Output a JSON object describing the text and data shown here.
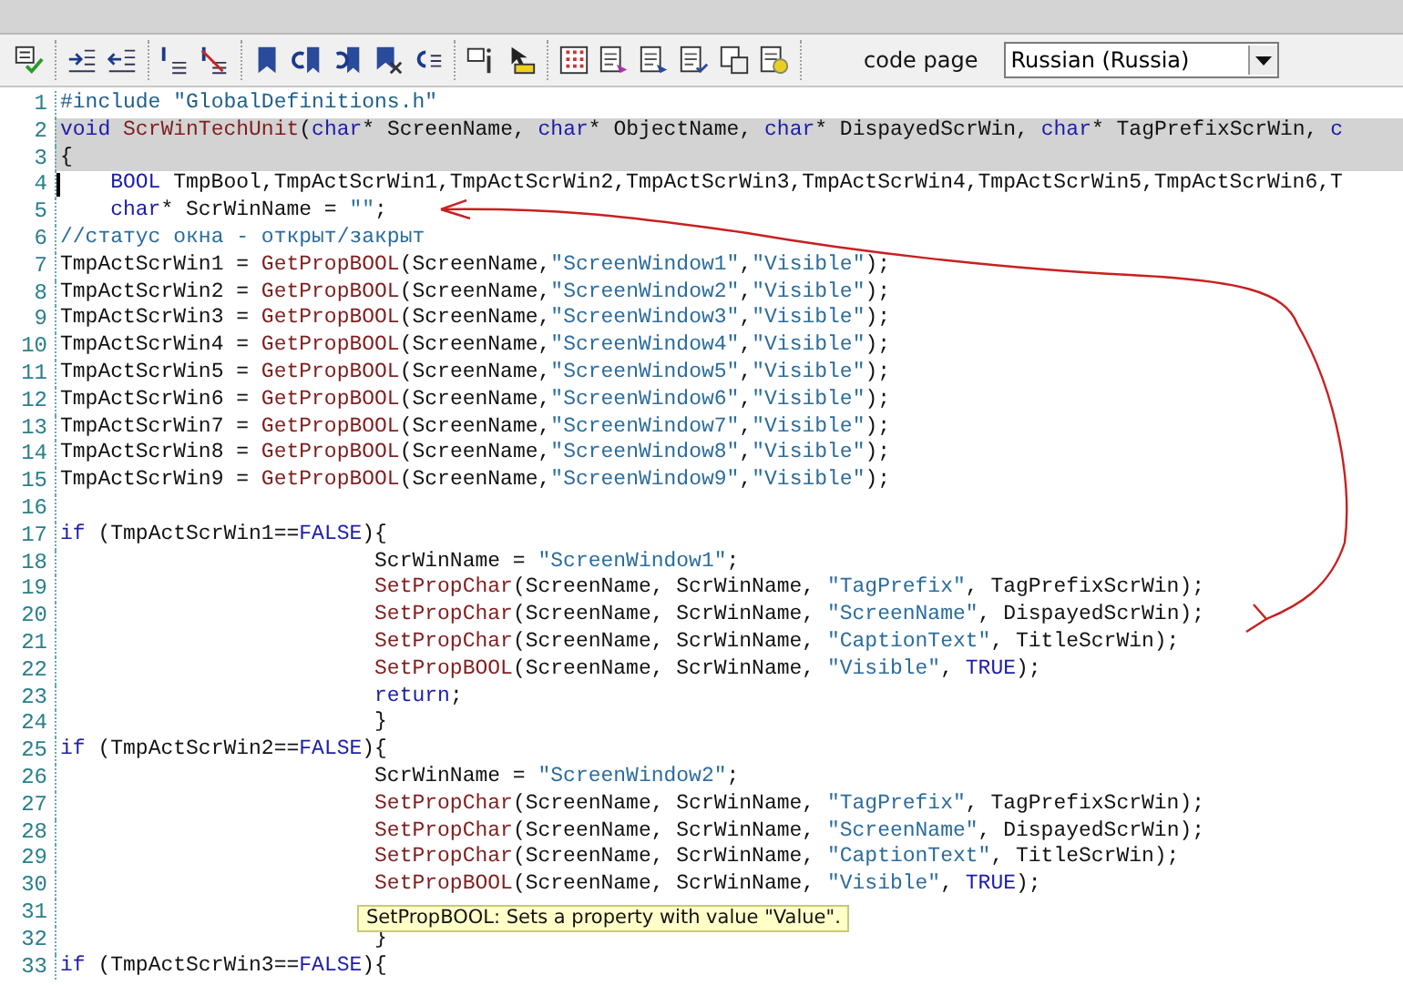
{
  "toolbar": {
    "code_page_label": "code page",
    "code_page_value": "Russian (Russia)"
  },
  "editor": {
    "lines": [
      {
        "number": "1",
        "kind": "top",
        "highlighted": false,
        "cursor": false,
        "tokens": [
          {
            "kind": "directive",
            "text": "#include \"GlobalDefinitions.h\""
          }
        ]
      },
      {
        "number": "2",
        "kind": "top",
        "highlighted": true,
        "cursor": false,
        "tokens": [
          {
            "kind": "keyword",
            "text": "void"
          },
          {
            "kind": "function",
            "text": " ScrWinTechUnit"
          },
          {
            "kind": "plain",
            "text": "("
          },
          {
            "kind": "keyword",
            "text": "char"
          },
          {
            "kind": "plain",
            "text": "* ScreenName, "
          },
          {
            "kind": "keyword",
            "text": "char"
          },
          {
            "kind": "plain",
            "text": "* ObjectName, "
          },
          {
            "kind": "keyword",
            "text": "char"
          },
          {
            "kind": "plain",
            "text": "* DispayedScrWin, "
          },
          {
            "kind": "keyword",
            "text": "char"
          },
          {
            "kind": "plain",
            "text": "* TagPrefixScrWin, "
          },
          {
            "kind": "keyword",
            "text": "c"
          }
        ]
      },
      {
        "number": "3",
        "kind": "top",
        "highlighted": true,
        "cursor": false,
        "tokens": [
          {
            "kind": "plain",
            "text": "{"
          }
        ]
      },
      {
        "number": "4",
        "kind": "body",
        "highlighted": false,
        "cursor": true,
        "tokens": [
          {
            "kind": "keyword",
            "text": "BOOL"
          },
          {
            "kind": "plain",
            "text": " TmpBool,TmpActScrWin1,TmpActScrWin2,TmpActScrWin3,TmpActScrWin4,TmpActScrWin5,TmpActScrWin6,T"
          }
        ]
      },
      {
        "number": "5",
        "kind": "body",
        "highlighted": false,
        "cursor": false,
        "tokens": [
          {
            "kind": "keyword",
            "text": "char"
          },
          {
            "kind": "plain",
            "text": "* ScrWinName = "
          },
          {
            "kind": "string",
            "text": "\"\""
          },
          {
            "kind": "plain",
            "text": ";"
          }
        ]
      },
      {
        "number": "6",
        "kind": "top",
        "highlighted": false,
        "cursor": false,
        "tokens": [
          {
            "kind": "comment",
            "text": "//статус окна - открыт/закрыт"
          }
        ]
      },
      {
        "number": "7",
        "kind": "top",
        "highlighted": false,
        "cursor": false,
        "tokens": [
          {
            "kind": "plain",
            "text": "TmpActScrWin1 = "
          },
          {
            "kind": "function",
            "text": "GetPropBOOL"
          },
          {
            "kind": "plain",
            "text": "(ScreenName,"
          },
          {
            "kind": "string",
            "text": "\"ScreenWindow1\""
          },
          {
            "kind": "plain",
            "text": ","
          },
          {
            "kind": "string",
            "text": "\"Visible\""
          },
          {
            "kind": "plain",
            "text": ");"
          }
        ]
      },
      {
        "number": "8",
        "kind": "top",
        "highlighted": false,
        "cursor": false,
        "tokens": [
          {
            "kind": "plain",
            "text": "TmpActScrWin2 = "
          },
          {
            "kind": "function",
            "text": "GetPropBOOL"
          },
          {
            "kind": "plain",
            "text": "(ScreenName,"
          },
          {
            "kind": "string",
            "text": "\"ScreenWindow2\""
          },
          {
            "kind": "plain",
            "text": ","
          },
          {
            "kind": "string",
            "text": "\"Visible\""
          },
          {
            "kind": "plain",
            "text": ");"
          }
        ]
      },
      {
        "number": "9",
        "kind": "top",
        "highlighted": false,
        "cursor": false,
        "tokens": [
          {
            "kind": "plain",
            "text": "TmpActScrWin3 = "
          },
          {
            "kind": "function",
            "text": "GetPropBOOL"
          },
          {
            "kind": "plain",
            "text": "(ScreenName,"
          },
          {
            "kind": "string",
            "text": "\"ScreenWindow3\""
          },
          {
            "kind": "plain",
            "text": ","
          },
          {
            "kind": "string",
            "text": "\"Visible\""
          },
          {
            "kind": "plain",
            "text": ");"
          }
        ]
      },
      {
        "number": "10",
        "kind": "top",
        "highlighted": false,
        "cursor": false,
        "tokens": [
          {
            "kind": "plain",
            "text": "TmpActScrWin4 = "
          },
          {
            "kind": "function",
            "text": "GetPropBOOL"
          },
          {
            "kind": "plain",
            "text": "(ScreenName,"
          },
          {
            "kind": "string",
            "text": "\"ScreenWindow4\""
          },
          {
            "kind": "plain",
            "text": ","
          },
          {
            "kind": "string",
            "text": "\"Visible\""
          },
          {
            "kind": "plain",
            "text": ");"
          }
        ]
      },
      {
        "number": "11",
        "kind": "top",
        "highlighted": false,
        "cursor": false,
        "tokens": [
          {
            "kind": "plain",
            "text": "TmpActScrWin5 = "
          },
          {
            "kind": "function",
            "text": "GetPropBOOL"
          },
          {
            "kind": "plain",
            "text": "(ScreenName,"
          },
          {
            "kind": "string",
            "text": "\"ScreenWindow5\""
          },
          {
            "kind": "plain",
            "text": ","
          },
          {
            "kind": "string",
            "text": "\"Visible\""
          },
          {
            "kind": "plain",
            "text": ");"
          }
        ]
      },
      {
        "number": "12",
        "kind": "top",
        "highlighted": false,
        "cursor": false,
        "tokens": [
          {
            "kind": "plain",
            "text": "TmpActScrWin6 = "
          },
          {
            "kind": "function",
            "text": "GetPropBOOL"
          },
          {
            "kind": "plain",
            "text": "(ScreenName,"
          },
          {
            "kind": "string",
            "text": "\"ScreenWindow6\""
          },
          {
            "kind": "plain",
            "text": ","
          },
          {
            "kind": "string",
            "text": "\"Visible\""
          },
          {
            "kind": "plain",
            "text": ");"
          }
        ]
      },
      {
        "number": "13",
        "kind": "top",
        "highlighted": false,
        "cursor": false,
        "tokens": [
          {
            "kind": "plain",
            "text": "TmpActScrWin7 = "
          },
          {
            "kind": "function",
            "text": "GetPropBOOL"
          },
          {
            "kind": "plain",
            "text": "(ScreenName,"
          },
          {
            "kind": "string",
            "text": "\"ScreenWindow7\""
          },
          {
            "kind": "plain",
            "text": ","
          },
          {
            "kind": "string",
            "text": "\"Visible\""
          },
          {
            "kind": "plain",
            "text": ");"
          }
        ]
      },
      {
        "number": "14",
        "kind": "top",
        "highlighted": false,
        "cursor": false,
        "tokens": [
          {
            "kind": "plain",
            "text": "TmpActScrWin8 = "
          },
          {
            "kind": "function",
            "text": "GetPropBOOL"
          },
          {
            "kind": "plain",
            "text": "(ScreenName,"
          },
          {
            "kind": "string",
            "text": "\"ScreenWindow8\""
          },
          {
            "kind": "plain",
            "text": ","
          },
          {
            "kind": "string",
            "text": "\"Visible\""
          },
          {
            "kind": "plain",
            "text": ");"
          }
        ]
      },
      {
        "number": "15",
        "kind": "top",
        "highlighted": false,
        "cursor": false,
        "tokens": [
          {
            "kind": "plain",
            "text": "TmpActScrWin9 = "
          },
          {
            "kind": "function",
            "text": "GetPropBOOL"
          },
          {
            "kind": "plain",
            "text": "(ScreenName,"
          },
          {
            "kind": "string",
            "text": "\"ScreenWindow9\""
          },
          {
            "kind": "plain",
            "text": ","
          },
          {
            "kind": "string",
            "text": "\"Visible\""
          },
          {
            "kind": "plain",
            "text": ");"
          }
        ]
      },
      {
        "number": "16",
        "kind": "top",
        "highlighted": false,
        "cursor": false
      },
      {
        "number": "17",
        "kind": "top",
        "highlighted": false,
        "cursor": false,
        "tokens": [
          {
            "kind": "keyword",
            "text": "if"
          },
          {
            "kind": "plain",
            "text": " (TmpActScrWin1=="
          },
          {
            "kind": "keyword",
            "text": "FALSE"
          },
          {
            "kind": "plain",
            "text": "){"
          }
        ]
      },
      {
        "number": "18",
        "kind": "inner",
        "highlighted": false,
        "cursor": false,
        "tokens": [
          {
            "kind": "plain",
            "text": "ScrWinName = "
          },
          {
            "kind": "string",
            "text": "\"ScreenWindow1\""
          },
          {
            "kind": "plain",
            "text": ";"
          }
        ]
      },
      {
        "number": "19",
        "kind": "inner",
        "highlighted": false,
        "cursor": false,
        "tokens": [
          {
            "kind": "function",
            "text": "SetPropChar"
          },
          {
            "kind": "plain",
            "text": "(ScreenName, ScrWinName, "
          },
          {
            "kind": "string",
            "text": "\"TagPrefix\""
          },
          {
            "kind": "plain",
            "text": ", TagPrefixScrWin);"
          }
        ]
      },
      {
        "number": "20",
        "kind": "inner",
        "highlighted": false,
        "cursor": false,
        "tokens": [
          {
            "kind": "function",
            "text": "SetPropChar"
          },
          {
            "kind": "plain",
            "text": "(ScreenName, ScrWinName, "
          },
          {
            "kind": "string",
            "text": "\"ScreenName\""
          },
          {
            "kind": "plain",
            "text": ", DispayedScrWin);"
          }
        ]
      },
      {
        "number": "21",
        "kind": "inner",
        "highlighted": false,
        "cursor": false,
        "tokens": [
          {
            "kind": "function",
            "text": "SetPropChar"
          },
          {
            "kind": "plain",
            "text": "(ScreenName, ScrWinName, "
          },
          {
            "kind": "string",
            "text": "\"CaptionText\""
          },
          {
            "kind": "plain",
            "text": ", TitleScrWin);"
          }
        ]
      },
      {
        "number": "22",
        "kind": "inner",
        "highlighted": false,
        "cursor": false,
        "tokens": [
          {
            "kind": "function",
            "text": "SetPropBOOL"
          },
          {
            "kind": "plain",
            "text": "(ScreenName, ScrWinName, "
          },
          {
            "kind": "string",
            "text": "\"Visible\""
          },
          {
            "kind": "plain",
            "text": ", "
          },
          {
            "kind": "keyword",
            "text": "TRUE"
          },
          {
            "kind": "plain",
            "text": ");"
          }
        ]
      },
      {
        "number": "23",
        "kind": "inner",
        "highlighted": false,
        "cursor": false,
        "tokens": [
          {
            "kind": "keyword",
            "text": "return"
          },
          {
            "kind": "plain",
            "text": ";"
          }
        ]
      },
      {
        "number": "24",
        "kind": "inner",
        "highlighted": false,
        "cursor": false,
        "tokens": [
          {
            "kind": "plain",
            "text": "}"
          }
        ]
      },
      {
        "number": "25",
        "kind": "top",
        "highlighted": false,
        "cursor": false,
        "tokens": [
          {
            "kind": "keyword",
            "text": "if"
          },
          {
            "kind": "plain",
            "text": " (TmpActScrWin2=="
          },
          {
            "kind": "keyword",
            "text": "FALSE"
          },
          {
            "kind": "plain",
            "text": "){"
          }
        ]
      },
      {
        "number": "26",
        "kind": "inner",
        "highlighted": false,
        "cursor": false,
        "tokens": [
          {
            "kind": "plain",
            "text": "ScrWinName = "
          },
          {
            "kind": "string",
            "text": "\"ScreenWindow2\""
          },
          {
            "kind": "plain",
            "text": ";"
          }
        ]
      },
      {
        "number": "27",
        "kind": "inner",
        "highlighted": false,
        "cursor": false,
        "tokens": [
          {
            "kind": "function",
            "text": "SetPropChar"
          },
          {
            "kind": "plain",
            "text": "(ScreenName, ScrWinName, "
          },
          {
            "kind": "string",
            "text": "\"TagPrefix\""
          },
          {
            "kind": "plain",
            "text": ", TagPrefixScrWin);"
          }
        ]
      },
      {
        "number": "28",
        "kind": "inner",
        "highlighted": false,
        "cursor": false,
        "tokens": [
          {
            "kind": "function",
            "text": "SetPropChar"
          },
          {
            "kind": "plain",
            "text": "(ScreenName, ScrWinName, "
          },
          {
            "kind": "string",
            "text": "\"ScreenName\""
          },
          {
            "kind": "plain",
            "text": ", DispayedScrWin);"
          }
        ]
      },
      {
        "number": "29",
        "kind": "inner",
        "highlighted": false,
        "cursor": false,
        "tokens": [
          {
            "kind": "function",
            "text": "SetPropChar"
          },
          {
            "kind": "plain",
            "text": "(ScreenName, ScrWinName, "
          },
          {
            "kind": "string",
            "text": "\"CaptionText\""
          },
          {
            "kind": "plain",
            "text": ", TitleScrWin);"
          }
        ]
      },
      {
        "number": "30",
        "kind": "inner",
        "highlighted": false,
        "cursor": false,
        "tokens": [
          {
            "kind": "function",
            "text": "SetPropBOOL"
          },
          {
            "kind": "plain",
            "text": "(ScreenName, ScrWinName, "
          },
          {
            "kind": "string",
            "text": "\"Visible\""
          },
          {
            "kind": "plain",
            "text": ", "
          },
          {
            "kind": "keyword",
            "text": "TRUE"
          },
          {
            "kind": "plain",
            "text": ");"
          }
        ]
      },
      {
        "number": "31",
        "kind": "inner",
        "highlighted": false,
        "cursor": false
      },
      {
        "number": "32",
        "kind": "inner",
        "highlighted": false,
        "cursor": false,
        "tokens": [
          {
            "kind": "plain",
            "text": "}"
          }
        ]
      },
      {
        "number": "33",
        "kind": "top",
        "highlighted": false,
        "cursor": false,
        "tokens": [
          {
            "kind": "keyword",
            "text": "if"
          },
          {
            "kind": "plain",
            "text": " (TmpActScrWin3=="
          },
          {
            "kind": "keyword",
            "text": "FALSE"
          },
          {
            "kind": "plain",
            "text": "){"
          }
        ]
      }
    ]
  },
  "tooltip": {
    "text": "SetPropBOOL: Sets a property with value \"Value\"."
  }
}
